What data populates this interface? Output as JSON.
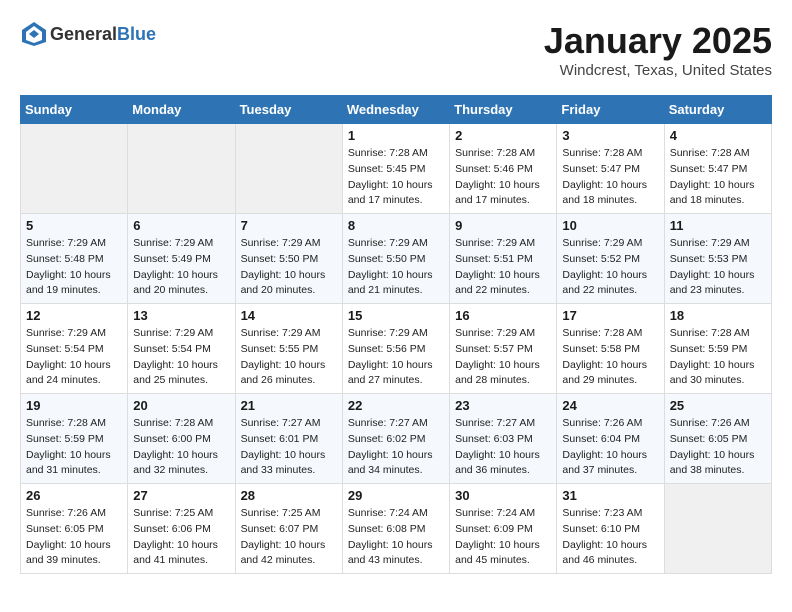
{
  "header": {
    "logo_general": "General",
    "logo_blue": "Blue",
    "title": "January 2025",
    "location": "Windcrest, Texas, United States"
  },
  "days_of_week": [
    "Sunday",
    "Monday",
    "Tuesday",
    "Wednesday",
    "Thursday",
    "Friday",
    "Saturday"
  ],
  "weeks": [
    [
      {
        "day": "",
        "info": ""
      },
      {
        "day": "",
        "info": ""
      },
      {
        "day": "",
        "info": ""
      },
      {
        "day": "1",
        "info": "Sunrise: 7:28 AM\nSunset: 5:45 PM\nDaylight: 10 hours\nand 17 minutes."
      },
      {
        "day": "2",
        "info": "Sunrise: 7:28 AM\nSunset: 5:46 PM\nDaylight: 10 hours\nand 17 minutes."
      },
      {
        "day": "3",
        "info": "Sunrise: 7:28 AM\nSunset: 5:47 PM\nDaylight: 10 hours\nand 18 minutes."
      },
      {
        "day": "4",
        "info": "Sunrise: 7:28 AM\nSunset: 5:47 PM\nDaylight: 10 hours\nand 18 minutes."
      }
    ],
    [
      {
        "day": "5",
        "info": "Sunrise: 7:29 AM\nSunset: 5:48 PM\nDaylight: 10 hours\nand 19 minutes."
      },
      {
        "day": "6",
        "info": "Sunrise: 7:29 AM\nSunset: 5:49 PM\nDaylight: 10 hours\nand 20 minutes."
      },
      {
        "day": "7",
        "info": "Sunrise: 7:29 AM\nSunset: 5:50 PM\nDaylight: 10 hours\nand 20 minutes."
      },
      {
        "day": "8",
        "info": "Sunrise: 7:29 AM\nSunset: 5:50 PM\nDaylight: 10 hours\nand 21 minutes."
      },
      {
        "day": "9",
        "info": "Sunrise: 7:29 AM\nSunset: 5:51 PM\nDaylight: 10 hours\nand 22 minutes."
      },
      {
        "day": "10",
        "info": "Sunrise: 7:29 AM\nSunset: 5:52 PM\nDaylight: 10 hours\nand 22 minutes."
      },
      {
        "day": "11",
        "info": "Sunrise: 7:29 AM\nSunset: 5:53 PM\nDaylight: 10 hours\nand 23 minutes."
      }
    ],
    [
      {
        "day": "12",
        "info": "Sunrise: 7:29 AM\nSunset: 5:54 PM\nDaylight: 10 hours\nand 24 minutes."
      },
      {
        "day": "13",
        "info": "Sunrise: 7:29 AM\nSunset: 5:54 PM\nDaylight: 10 hours\nand 25 minutes."
      },
      {
        "day": "14",
        "info": "Sunrise: 7:29 AM\nSunset: 5:55 PM\nDaylight: 10 hours\nand 26 minutes."
      },
      {
        "day": "15",
        "info": "Sunrise: 7:29 AM\nSunset: 5:56 PM\nDaylight: 10 hours\nand 27 minutes."
      },
      {
        "day": "16",
        "info": "Sunrise: 7:29 AM\nSunset: 5:57 PM\nDaylight: 10 hours\nand 28 minutes."
      },
      {
        "day": "17",
        "info": "Sunrise: 7:28 AM\nSunset: 5:58 PM\nDaylight: 10 hours\nand 29 minutes."
      },
      {
        "day": "18",
        "info": "Sunrise: 7:28 AM\nSunset: 5:59 PM\nDaylight: 10 hours\nand 30 minutes."
      }
    ],
    [
      {
        "day": "19",
        "info": "Sunrise: 7:28 AM\nSunset: 5:59 PM\nDaylight: 10 hours\nand 31 minutes."
      },
      {
        "day": "20",
        "info": "Sunrise: 7:28 AM\nSunset: 6:00 PM\nDaylight: 10 hours\nand 32 minutes."
      },
      {
        "day": "21",
        "info": "Sunrise: 7:27 AM\nSunset: 6:01 PM\nDaylight: 10 hours\nand 33 minutes."
      },
      {
        "day": "22",
        "info": "Sunrise: 7:27 AM\nSunset: 6:02 PM\nDaylight: 10 hours\nand 34 minutes."
      },
      {
        "day": "23",
        "info": "Sunrise: 7:27 AM\nSunset: 6:03 PM\nDaylight: 10 hours\nand 36 minutes."
      },
      {
        "day": "24",
        "info": "Sunrise: 7:26 AM\nSunset: 6:04 PM\nDaylight: 10 hours\nand 37 minutes."
      },
      {
        "day": "25",
        "info": "Sunrise: 7:26 AM\nSunset: 6:05 PM\nDaylight: 10 hours\nand 38 minutes."
      }
    ],
    [
      {
        "day": "26",
        "info": "Sunrise: 7:26 AM\nSunset: 6:05 PM\nDaylight: 10 hours\nand 39 minutes."
      },
      {
        "day": "27",
        "info": "Sunrise: 7:25 AM\nSunset: 6:06 PM\nDaylight: 10 hours\nand 41 minutes."
      },
      {
        "day": "28",
        "info": "Sunrise: 7:25 AM\nSunset: 6:07 PM\nDaylight: 10 hours\nand 42 minutes."
      },
      {
        "day": "29",
        "info": "Sunrise: 7:24 AM\nSunset: 6:08 PM\nDaylight: 10 hours\nand 43 minutes."
      },
      {
        "day": "30",
        "info": "Sunrise: 7:24 AM\nSunset: 6:09 PM\nDaylight: 10 hours\nand 45 minutes."
      },
      {
        "day": "31",
        "info": "Sunrise: 7:23 AM\nSunset: 6:10 PM\nDaylight: 10 hours\nand 46 minutes."
      },
      {
        "day": "",
        "info": ""
      }
    ]
  ]
}
